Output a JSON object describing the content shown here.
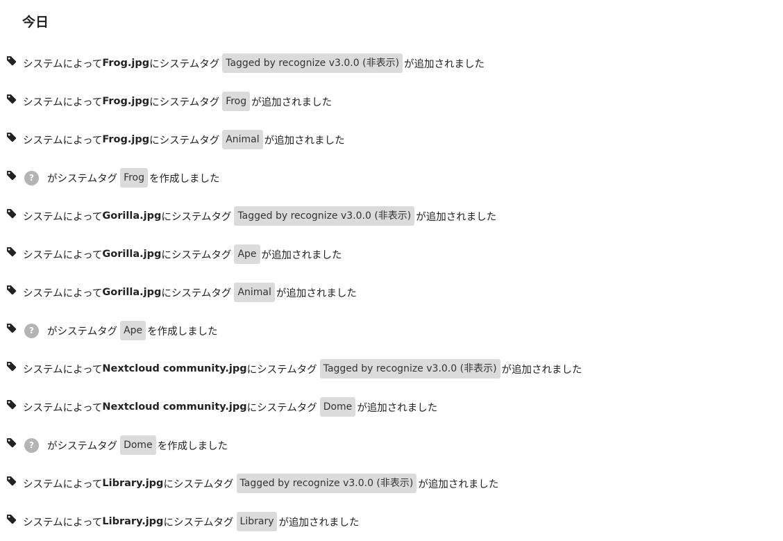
{
  "section": {
    "heading": "今日"
  },
  "unknown_user_glyph": "?",
  "icon": "tag-icon",
  "activities": [
    {
      "kind": "added",
      "prefix": "システムによって",
      "file": "Frog.jpg",
      "middle": "にシステムタグ",
      "tag": "Tagged by recognize v3.0.0 (非表示)",
      "suffix": "が追加されました"
    },
    {
      "kind": "added",
      "prefix": "システムによって",
      "file": "Frog.jpg",
      "middle": "にシステムタグ",
      "tag": "Frog",
      "suffix": "が追加されました"
    },
    {
      "kind": "added",
      "prefix": "システムによって",
      "file": "Frog.jpg",
      "middle": "にシステムタグ",
      "tag": "Animal",
      "suffix": "が追加されました"
    },
    {
      "kind": "created",
      "middle": "がシステムタグ",
      "tag": "Frog",
      "suffix": "を作成しました"
    },
    {
      "kind": "added",
      "prefix": "システムによって",
      "file": "Gorilla.jpg",
      "middle": "にシステムタグ",
      "tag": "Tagged by recognize v3.0.0 (非表示)",
      "suffix": "が追加されました"
    },
    {
      "kind": "added",
      "prefix": "システムによって",
      "file": "Gorilla.jpg",
      "middle": "にシステムタグ",
      "tag": "Ape",
      "suffix": "が追加されました"
    },
    {
      "kind": "added",
      "prefix": "システムによって",
      "file": "Gorilla.jpg",
      "middle": "にシステムタグ",
      "tag": "Animal",
      "suffix": "が追加されました"
    },
    {
      "kind": "created",
      "middle": "がシステムタグ",
      "tag": "Ape",
      "suffix": "を作成しました"
    },
    {
      "kind": "added",
      "prefix": "システムによって",
      "file": "Nextcloud community.jpg",
      "middle": "にシステムタグ",
      "tag": "Tagged by recognize v3.0.0 (非表示)",
      "suffix": "が追加されました"
    },
    {
      "kind": "added",
      "prefix": "システムによって",
      "file": "Nextcloud community.jpg",
      "middle": "にシステムタグ",
      "tag": "Dome",
      "suffix": "が追加されました"
    },
    {
      "kind": "created",
      "middle": "がシステムタグ",
      "tag": "Dome",
      "suffix": "を作成しました"
    },
    {
      "kind": "added",
      "prefix": "システムによって",
      "file": "Library.jpg",
      "middle": "にシステムタグ",
      "tag": "Tagged by recognize v3.0.0 (非表示)",
      "suffix": "が追加されました"
    },
    {
      "kind": "added",
      "prefix": "システムによって",
      "file": "Library.jpg",
      "middle": "にシステムタグ",
      "tag": "Library",
      "suffix": "が追加されました"
    }
  ]
}
